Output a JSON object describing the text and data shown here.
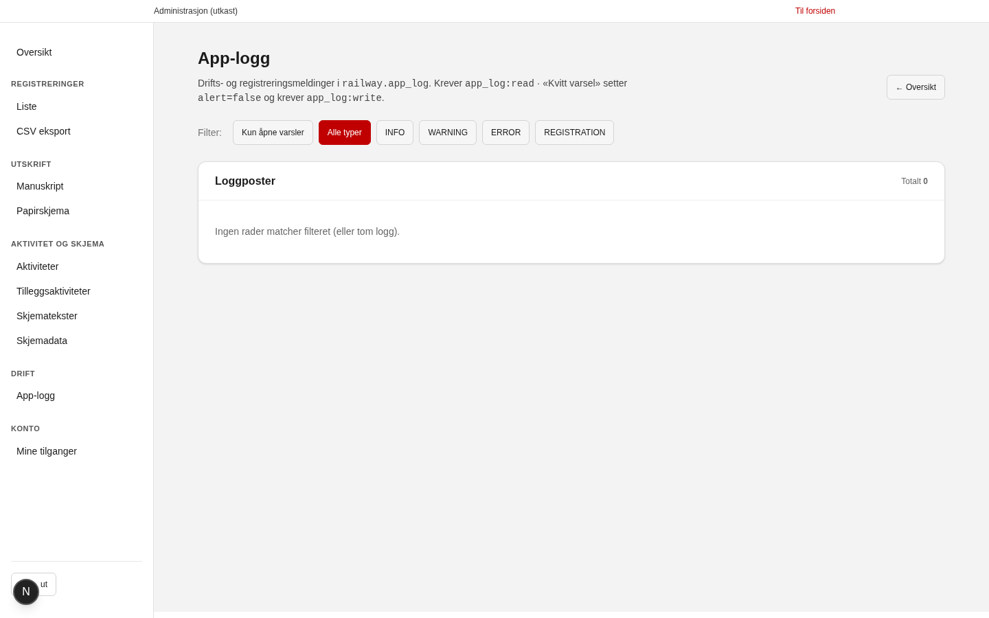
{
  "topbar": {
    "title": "Administrasjon (utkast)",
    "home_link": "Til forsiden"
  },
  "sidebar": {
    "top_item": "Oversikt",
    "sections": [
      {
        "heading": "REGISTRERINGER",
        "items": [
          "Liste",
          "CSV eksport"
        ]
      },
      {
        "heading": "UTSKRIFT",
        "items": [
          "Manuskript",
          "Papirskjema"
        ]
      },
      {
        "heading": "AKTIVITET OG SKJEMA",
        "items": [
          "Aktiviteter",
          "Tilleggsaktiviteter",
          "Skjematekster",
          "Skjemadata"
        ]
      },
      {
        "heading": "DRIFT",
        "items": [
          "App-logg"
        ]
      },
      {
        "heading": "KONTO",
        "items": [
          "Mine tilganger"
        ]
      }
    ],
    "logout_label": "ut",
    "dev_badge": "N"
  },
  "page": {
    "title": "App-logg",
    "description": [
      {
        "kind": "text",
        "text": "Drifts- og registreringsmeldinger i "
      },
      {
        "kind": "code",
        "text": "railway.app_log"
      },
      {
        "kind": "text",
        "text": ". Krever "
      },
      {
        "kind": "code",
        "text": "app_log:read"
      },
      {
        "kind": "text",
        "text": " · «Kvitt varsel» setter "
      },
      {
        "kind": "code",
        "text": "alert=false"
      },
      {
        "kind": "text",
        "text": " og krever "
      },
      {
        "kind": "code",
        "text": "app_log:write"
      },
      {
        "kind": "text",
        "text": "."
      }
    ],
    "back_button": "← Oversikt",
    "filter_label": "Filter:",
    "filters": [
      {
        "label": "Kun åpne varsler",
        "selected": false
      },
      {
        "label": "Alle typer",
        "selected": true
      },
      {
        "label": "INFO",
        "selected": false
      },
      {
        "label": "WARNING",
        "selected": false
      },
      {
        "label": "ERROR",
        "selected": false
      },
      {
        "label": "REGISTRATION",
        "selected": false
      }
    ],
    "card": {
      "title": "Loggposter",
      "total": "Totalt **0**",
      "empty_message": "Ingen rader matcher filteret (eller tom logg)."
    }
  }
}
